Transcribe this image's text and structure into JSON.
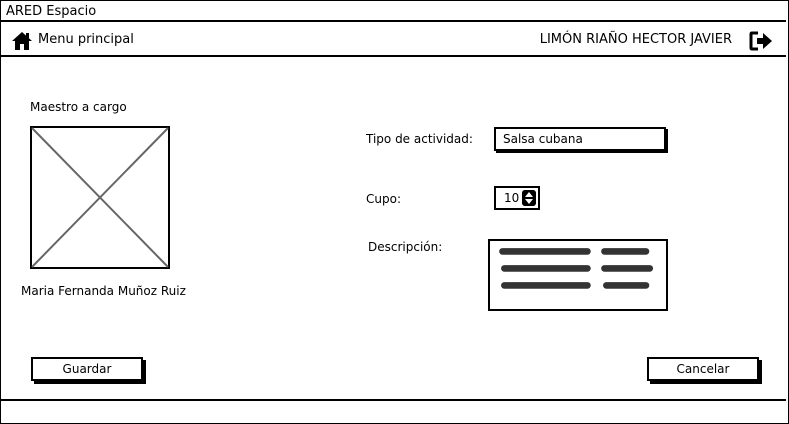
{
  "window": {
    "title": "ARED Espacio"
  },
  "navbar": {
    "menu_label": "Menu principal",
    "user_name": "LIMÓN RIAÑO HECTOR JAVIER",
    "home_icon": "home-icon",
    "logout_icon": "logout-icon"
  },
  "teacher": {
    "title": "Maestro a cargo",
    "name": "Maria Fernanda Muñoz Ruiz"
  },
  "form": {
    "activity_type_label": "Tipo de actividad:",
    "activity_type_value": "Salsa cubana",
    "capacity_label": "Cupo:",
    "capacity_value": "10",
    "description_label": "Descripción:"
  },
  "actions": {
    "save_label": "Guardar",
    "cancel_label": "Cancelar"
  }
}
